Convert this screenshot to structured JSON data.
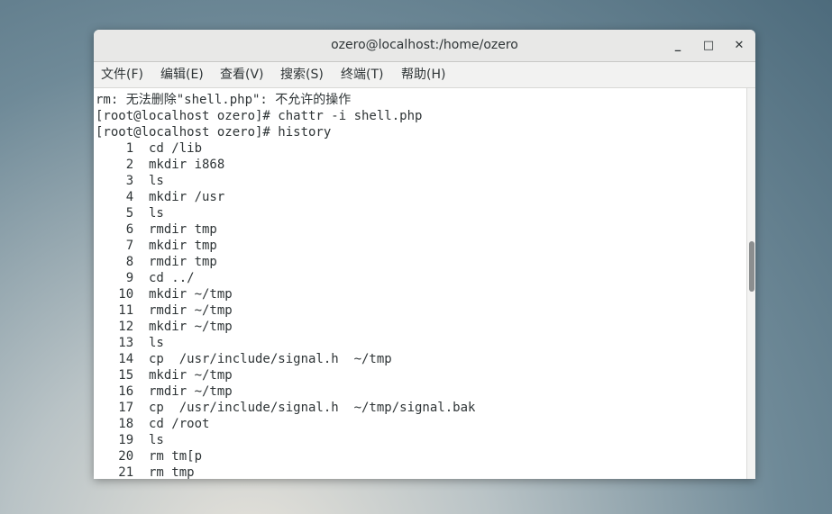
{
  "window": {
    "title": "ozero@localhost:/home/ozero",
    "minimize_glyph": "_",
    "maximize_glyph": "□",
    "close_glyph": "✕"
  },
  "menu": [
    {
      "label": "文件(F)"
    },
    {
      "label": "编辑(E)"
    },
    {
      "label": "查看(V)"
    },
    {
      "label": "搜索(S)"
    },
    {
      "label": "终端(T)"
    },
    {
      "label": "帮助(H)"
    }
  ],
  "terminal": {
    "lines": [
      "rm: 无法删除\"shell.php\": 不允许的操作",
      "[root@localhost ozero]# chattr -i shell.php",
      "[root@localhost ozero]# history",
      "    1  cd /lib",
      "    2  mkdir i868",
      "    3  ls",
      "    4  mkdir /usr",
      "    5  ls",
      "    6  rmdir tmp",
      "    7  mkdir tmp",
      "    8  rmdir tmp",
      "    9  cd ../",
      "   10  mkdir ~/tmp",
      "   11  rmdir ~/tmp",
      "   12  mkdir ~/tmp",
      "   13  ls",
      "   14  cp  /usr/include/signal.h  ~/tmp",
      "   15  mkdir ~/tmp",
      "   16  rmdir ~/tmp",
      "   17  cp  /usr/include/signal.h  ~/tmp/signal.bak",
      "   18  cd /root",
      "   19  ls",
      "   20  rm tm[p",
      "   21  rm tmp"
    ]
  }
}
